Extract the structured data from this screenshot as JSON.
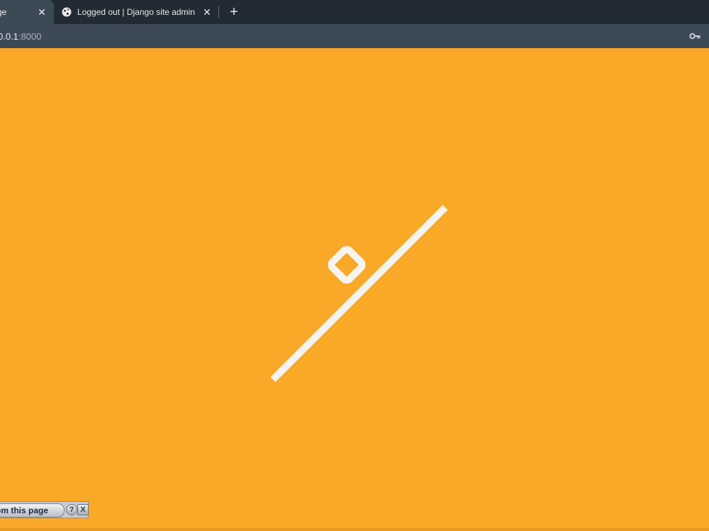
{
  "browser": {
    "tabs": [
      {
        "title": "ge",
        "close_glyph": "✕",
        "active": true
      },
      {
        "title": "Logged out | Django site admin",
        "close_glyph": "✕",
        "active": false,
        "icon": "globe-icon"
      }
    ],
    "new_tab_glyph": "+",
    "address": {
      "host": "0.0.1",
      "port": ":8000"
    },
    "key_icon": "key-icon"
  },
  "page": {
    "background": "#f9a827",
    "illustration": "loading-slash-diamond"
  },
  "overlay": {
    "button_label": "om this page",
    "help_label": "?",
    "close_label": "X"
  },
  "colors": {
    "tabbar": "#222a33",
    "toolbar": "#3c4a56",
    "accent": "#f9a827",
    "illustration": "#f5f4ef"
  }
}
